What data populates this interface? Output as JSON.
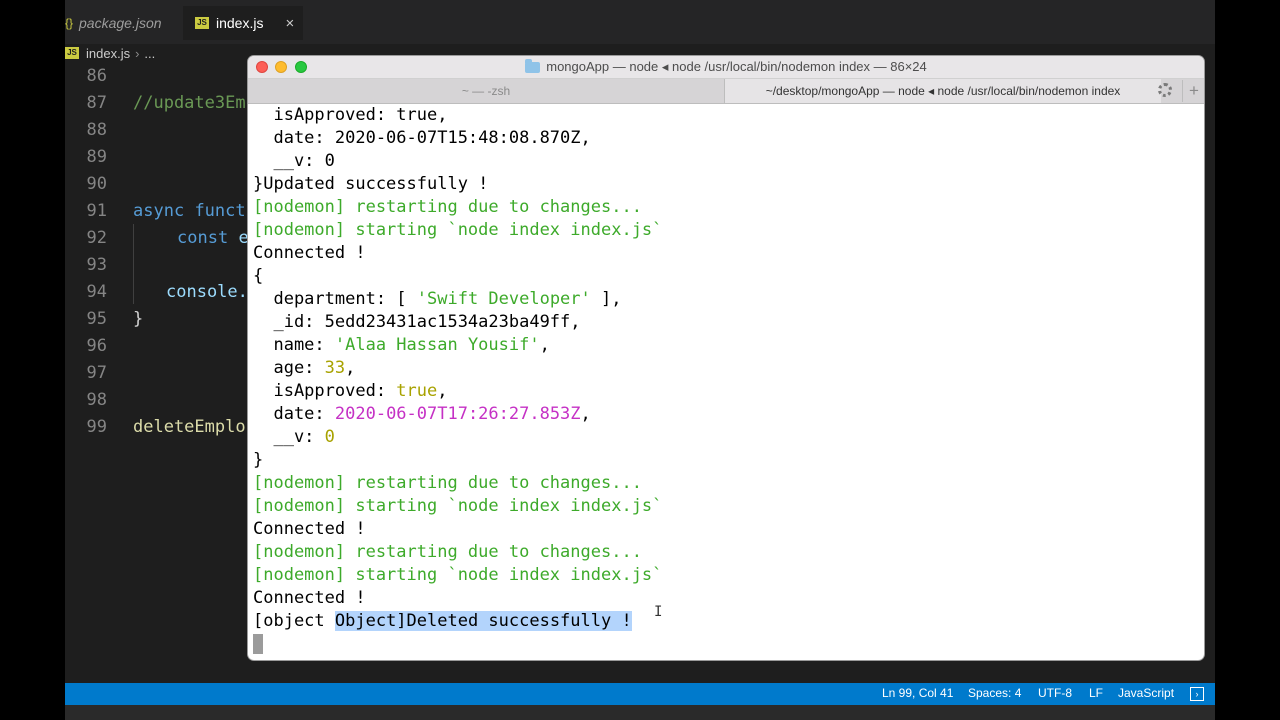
{
  "editor": {
    "tabs": [
      {
        "label": "package.json",
        "icon": "json-icon"
      },
      {
        "label": "index.js",
        "icon": "js-icon",
        "close": "×"
      }
    ],
    "breadcrumb": {
      "file": "index.js",
      "rest": "..."
    },
    "lines": [
      {
        "num": "86",
        "text": ""
      },
      {
        "num": "87",
        "text": "//update3Em"
      },
      {
        "num": "88",
        "text": ""
      },
      {
        "num": "89",
        "text": ""
      },
      {
        "num": "90",
        "text": ""
      },
      {
        "num": "91",
        "kw": "async",
        "fn": "funct"
      },
      {
        "num": "92",
        "kw": "const",
        "rest": "e"
      },
      {
        "num": "93",
        "text": ""
      },
      {
        "num": "94",
        "text": "console."
      },
      {
        "num": "95",
        "text": "}"
      },
      {
        "num": "96",
        "text": ""
      },
      {
        "num": "97",
        "text": ""
      },
      {
        "num": "98",
        "text": ""
      },
      {
        "num": "99",
        "text": "deleteEmplo"
      }
    ],
    "status": {
      "position": "Ln 99, Col 41",
      "spaces": "Spaces: 4",
      "encoding": "UTF-8",
      "eol": "LF",
      "language": "JavaScript"
    }
  },
  "terminal": {
    "title": "mongoApp — node ◂ node /usr/local/bin/nodemon index — 86×24",
    "tab1": "~ — -zsh",
    "tab2": "~/desktop/mongoApp — node ◂ node /usr/local/bin/nodemon index",
    "plus": "+",
    "lines": {
      "l1": "  isApproved: true,",
      "l2": "  date: 2020-06-07T15:48:08.870Z,",
      "l3": "  __v: 0",
      "l4": "}Updated successfully !",
      "l5": "[nodemon] restarting due to changes...",
      "l6": "[nodemon] starting `node index index.js`",
      "l7": "Connected !",
      "l8": "{",
      "dep_key": "  department: [ ",
      "dep_val": "'Swift Developer'",
      "dep_end": " ],",
      "l10": "  _id: 5edd23431ac1534a23ba49ff,",
      "name_key": "  name: ",
      "name_val": "'Alaa Hassan Yousif'",
      "name_end": ",",
      "age_key": "  age: ",
      "age_val": "33",
      "age_end": ",",
      "appr_key": "  isApproved: ",
      "appr_val": "true",
      "appr_end": ",",
      "date_key": "  date: ",
      "date_val": "2020-06-07T17:26:27.853Z",
      "date_end": ",",
      "v_key": "  __v: ",
      "v_val": "0",
      "l16": "}",
      "l17": "[nodemon] restarting due to changes...",
      "l18": "[nodemon] starting `node index index.js`",
      "l19": "Connected !",
      "l20": "[nodemon] restarting due to changes...",
      "l21": "[nodemon] starting `node index index.js`",
      "l22": "Connected !",
      "last_pre": "[object ",
      "last_sel": "Object]Deleted successfully !"
    }
  },
  "colors": {
    "nodemon": "#3daa2a",
    "number": "#a8a200",
    "date": "#c531c5",
    "selection": "#b3d4fc",
    "statusbar": "#007acc"
  }
}
